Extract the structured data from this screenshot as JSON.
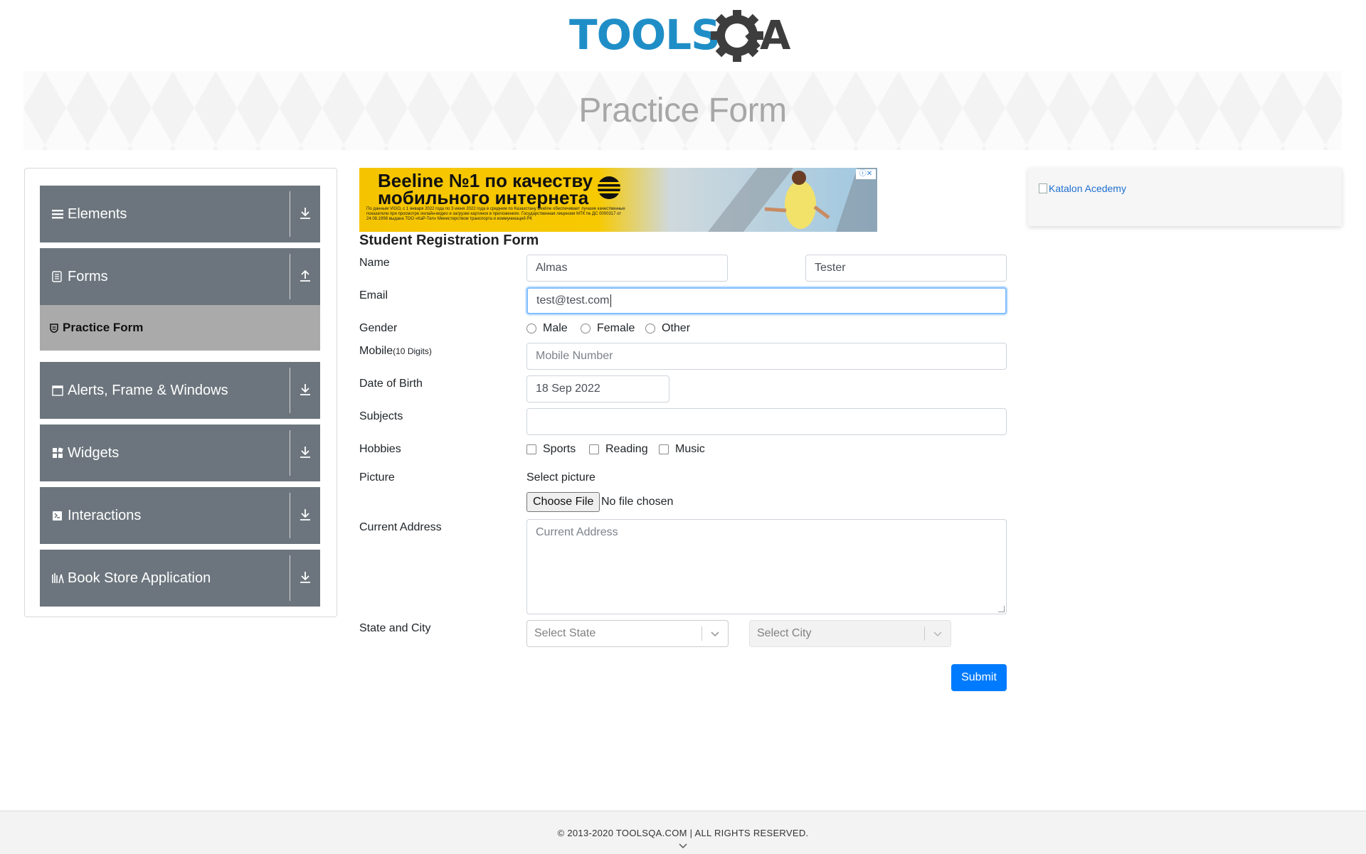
{
  "header": {
    "logo_text_left": "TOOLS",
    "logo_text_right": "QA",
    "page_title": "Practice Form"
  },
  "sidebar": {
    "groups": [
      {
        "label": "Elements",
        "icon": "hamburger-icon",
        "state": "collapsed"
      },
      {
        "label": "Forms",
        "icon": "document-icon",
        "state": "expanded"
      },
      {
        "label": "Alerts, Frame & Windows",
        "icon": "window-icon",
        "state": "collapsed"
      },
      {
        "label": "Widgets",
        "icon": "widgets-icon",
        "state": "collapsed"
      },
      {
        "label": "Interactions",
        "icon": "interactions-icon",
        "state": "collapsed"
      },
      {
        "label": "Book Store Application",
        "icon": "books-icon",
        "state": "collapsed"
      }
    ],
    "active_item": "Practice Form"
  },
  "ad": {
    "headline_line1": "Beeline №1 по качеству",
    "headline_line2": "мобильного интернета",
    "fine_print": "По данным VIGO, с 1 января 2022 года по 3 июня 2022 года в среднем по Казахстану Beeline обеспечивает лучшие качественные показатели при просмотре онлайн-видео и загрузке картинок в приложениях. Государственная лицензия МТК № ДС 0000317 от 24.08.1998 выдана ТОО «КаР-Тел» Министерством транспорта и коммуникаций РК"
  },
  "form": {
    "title": "Student Registration Form",
    "name_label": "Name",
    "first_name": "Almas",
    "last_name": "Tester",
    "email_label": "Email",
    "email": "test@test.com",
    "gender_label": "Gender",
    "gender_options": [
      "Male",
      "Female",
      "Other"
    ],
    "mobile_label": "Mobile",
    "mobile_hint": "(10 Digits)",
    "mobile_placeholder": "Mobile Number",
    "dob_label": "Date of Birth",
    "dob": "18 Sep 2022",
    "subjects_label": "Subjects",
    "hobbies_label": "Hobbies",
    "hobbies": [
      "Sports",
      "Reading",
      "Music"
    ],
    "picture_label": "Picture",
    "select_picture": "Select picture",
    "choose_file": "Choose File",
    "no_file": "No file chosen",
    "address_label": "Current Address",
    "address_placeholder": "Current Address",
    "state_city_label": "State and City",
    "state_placeholder": "Select State",
    "city_placeholder": "Select City",
    "submit": "Submit"
  },
  "right_panel": {
    "link_text": "Katalon Acedemy"
  },
  "footer": {
    "copyright": "© 2013-2020 TOOLSQA.COM | ALL RIGHTS RESERVED."
  },
  "colors": {
    "brand_blue": "#1f8ec7",
    "logo_dark": "#3d3d3d",
    "sidebar_bg": "#6c757d",
    "active_item_bg": "#aaaaaa",
    "primary": "#007bff"
  }
}
